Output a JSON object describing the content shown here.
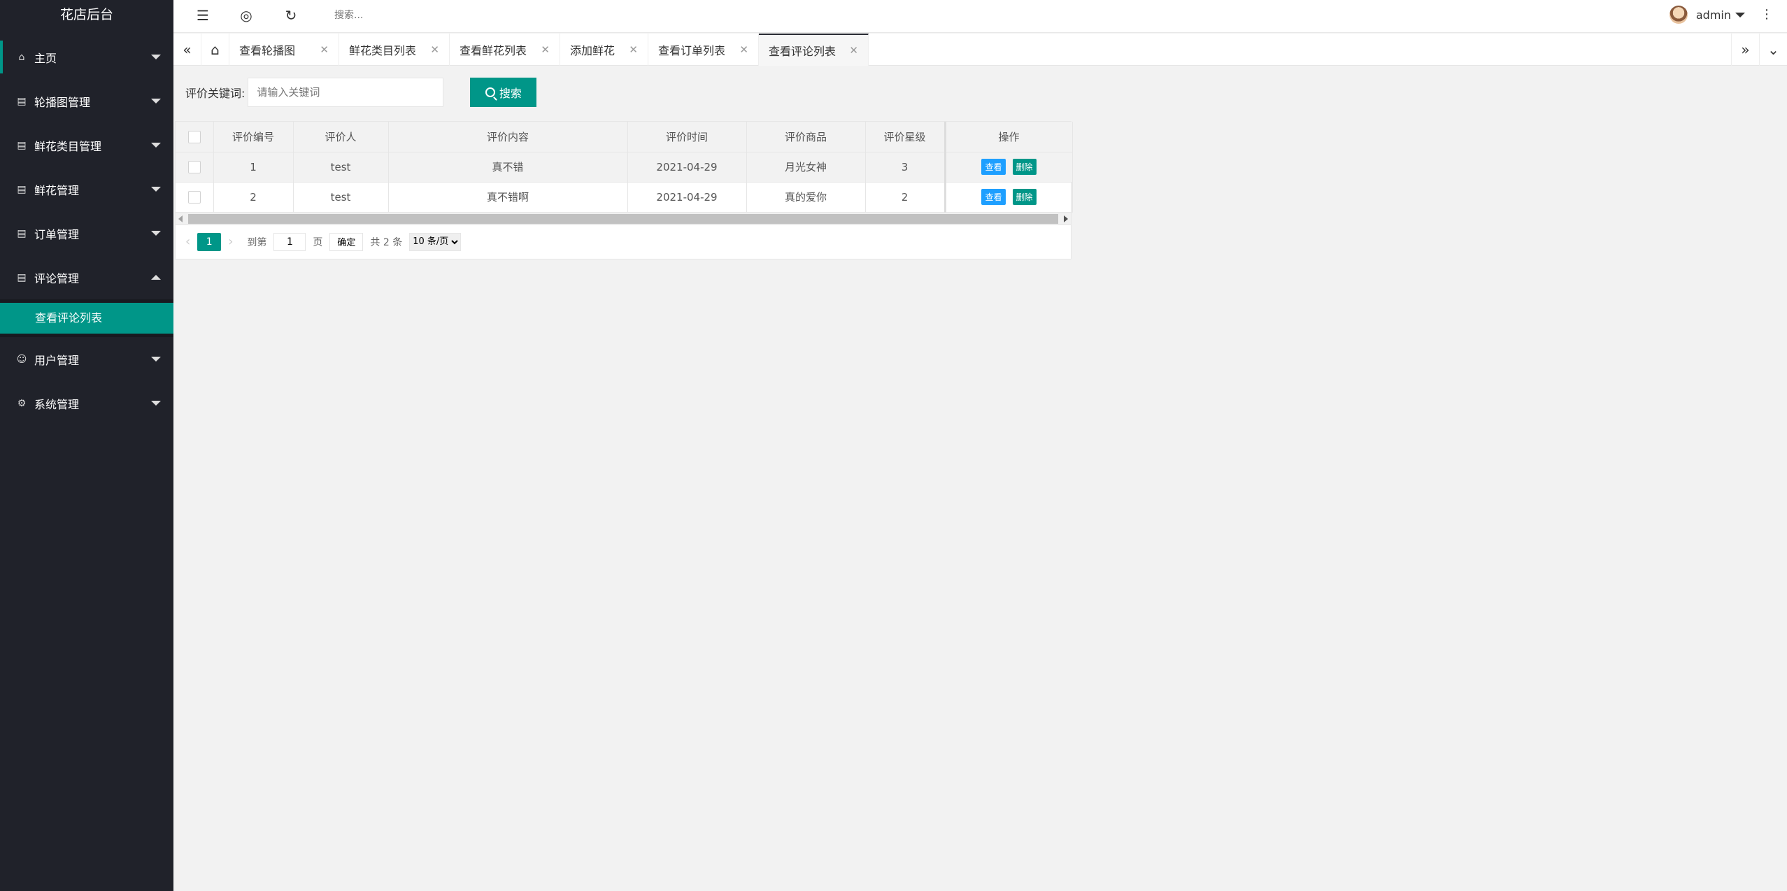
{
  "app": {
    "title": "花店后台"
  },
  "sidebar": {
    "items": [
      {
        "label": "主页",
        "icon": "home-icon",
        "expanded": false
      },
      {
        "label": "轮播图管理",
        "icon": "menu-icon",
        "expanded": false
      },
      {
        "label": "鲜花类目管理",
        "icon": "menu-icon",
        "expanded": false
      },
      {
        "label": "鲜花管理",
        "icon": "menu-icon",
        "expanded": false
      },
      {
        "label": "订单管理",
        "icon": "menu-icon",
        "expanded": false
      },
      {
        "label": "评论管理",
        "icon": "menu-icon",
        "expanded": true,
        "children": [
          {
            "label": "查看评论列表",
            "active": true
          }
        ]
      },
      {
        "label": "用户管理",
        "icon": "user-icon",
        "expanded": false
      },
      {
        "label": "系统管理",
        "icon": "gear-icon",
        "expanded": false
      }
    ]
  },
  "header": {
    "search_placeholder": "搜索...",
    "user_name": "admin"
  },
  "tabs": [
    {
      "label": "查看轮播图"
    },
    {
      "label": "鲜花类目列表"
    },
    {
      "label": "查看鲜花列表"
    },
    {
      "label": "添加鲜花"
    },
    {
      "label": "查看订单列表"
    },
    {
      "label": "查看评论列表",
      "active": true
    }
  ],
  "search": {
    "label": "评价关键词:",
    "placeholder": "请输入关键词",
    "button_label": "搜索"
  },
  "table": {
    "columns": [
      "评价编号",
      "评价人",
      "评价内容",
      "评价时间",
      "评价商品",
      "评价星级",
      "操作"
    ],
    "rows": [
      {
        "id": "1",
        "user": "test",
        "content": "真不错",
        "time": "2021-04-29",
        "product": "月光女神",
        "stars": "3"
      },
      {
        "id": "2",
        "user": "test",
        "content": "真不错啊",
        "time": "2021-04-29",
        "product": "真的爱你",
        "stars": "2"
      }
    ],
    "view_label": "查看",
    "delete_label": "删除"
  },
  "pager": {
    "current": "1",
    "goto_label": "到第",
    "page_input": "1",
    "page_unit": "页",
    "ok_label": "确定",
    "total": "共 2 条",
    "page_size": "10 条/页"
  },
  "colors": {
    "sidebar_bg": "#20222a",
    "accent": "#009688",
    "blue": "#1e9fff"
  }
}
